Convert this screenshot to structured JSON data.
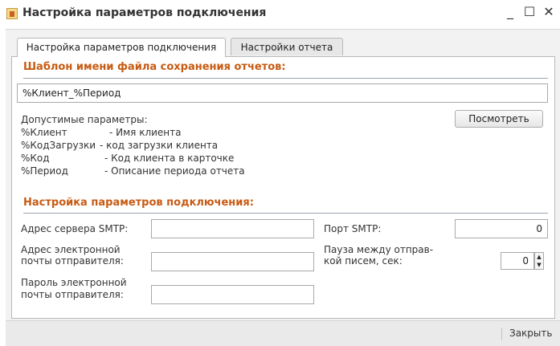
{
  "window": {
    "title": "Настройка параметров подключения",
    "minimize": "_",
    "maximize": "☐",
    "close": "✕"
  },
  "tabs": [
    {
      "label": "Настройка параметров подключения",
      "active": true
    },
    {
      "label": "Настройки отчета",
      "active": false
    }
  ],
  "file_template": {
    "section_title": "Шаблон имени файла сохранения отчетов:",
    "value": "%Клиент_%Период",
    "params_header": "Допустимые параметры:",
    "params": [
      {
        "name": "%Клиент",
        "desc": "- Имя клиента"
      },
      {
        "name": "%КодЗагрузки",
        "desc": "- код загрузки клиента"
      },
      {
        "name": "%Код",
        "desc": "- Код клиента в карточке"
      },
      {
        "name": "%Период",
        "desc": "- Описание периода отчета"
      }
    ],
    "view_button": "Посмотреть"
  },
  "connection": {
    "section_title": "Настройка параметров подключения:",
    "smtp_server_label": "Адрес сервера SMTP:",
    "smtp_server_value": "",
    "sender_email_label_1": "Адрес электронной",
    "sender_email_label_2": "почты отправителя:",
    "sender_email_value": "",
    "sender_password_label_1": "Пароль электронной",
    "sender_password_label_2": "почты отправителя:",
    "sender_password_value": "",
    "smtp_port_label": "Порт SMTP:",
    "smtp_port_value": "0",
    "pause_label_1": "Пауза между отправ-",
    "pause_label_2": "кой писем, сек:",
    "pause_value": "0"
  },
  "footer": {
    "close_button": "Закрыть"
  }
}
